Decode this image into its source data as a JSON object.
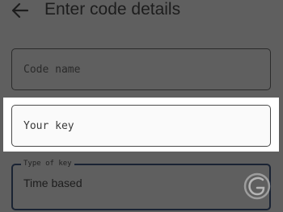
{
  "header": {
    "title": "Enter code details",
    "back_icon": "arrow-back-icon"
  },
  "form": {
    "code_name": {
      "placeholder": "Code name",
      "value": ""
    },
    "your_key": {
      "placeholder": "Your key",
      "value": ""
    },
    "type_of_key": {
      "label": "Type of key",
      "value": "Time based",
      "icon": "chevron-down-icon"
    }
  },
  "watermark_icon": "logo-watermark-icon",
  "colors": {
    "overlay_bg": "#5f5f5f",
    "highlight": "#ffffff",
    "text_dark": "#1d1d1d",
    "focus_border": "#1a2333"
  }
}
